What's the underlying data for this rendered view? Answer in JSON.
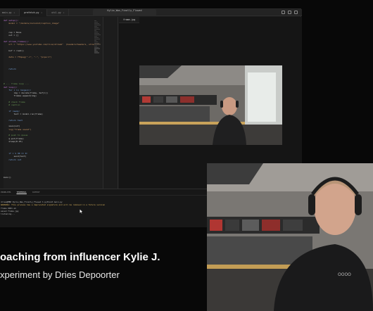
{
  "ide": {
    "window_title": "Kylie_Was_Finally_Flowed",
    "tabs": [
      {
        "label": "main.py",
        "active": false
      },
      {
        "label": "prefetch.py",
        "active": true
      },
      {
        "label": "util.py",
        "active": false
      }
    ],
    "preview_tab": "frame.jpg",
    "code_lines": [
      "def setup():",
      "    model = \"/models/zeroshot/caption_image\"",
      "",
      "",
      "    cap = None",
      "    out = []",
      "",
      "def stream_frames():",
      "    url = \"https://www.youtube.com/live/stream\"  (headers=headers, stream=True)",
      "",
      "    buf = read()",
      "",
      "    data = ffmpeg(\"-i\", \"-\", \"pipe:1\")",
      "",
      "",
      "",
      "    return",
      "",
      "",
      "",
      "",
      "# --- frame loop ---",
      "def loop():",
      "    for i in range(n):",
      "        img = decode(frame, buf[i])",
      "        frames.append(img)",
      "",
      "    # check frame",
      "    # caption",
      "",
      "    if ready:",
      "        text = model.run(frame)",
      "",
      "    return text",
      "",
      "    save(out)",
      "    log(\"frame saved\")",
      "",
      "    # push to queue",
      "    q.put(frame)",
      "    sleep(0.25)",
      "",
      "",
      "",
      "    if i % 30 == 0:",
      "        send(text)",
      "    return out",
      "",
      "",
      "",
      "",
      "",
      "main()"
    ],
    "terminal": {
      "tabs": [
        {
          "label": "PROBLEMS",
          "active": false
        },
        {
          "label": "TERMINAL",
          "active": true
        },
        {
          "label": "OUTPUT",
          "active": false
        }
      ],
      "lines": [
        "",
        "dries@MBP Kylie_Was_Finally_Flowed % python3 main.py",
        "WARNING: This process has a deprecated signature and will be removed in a future version",
        "frame 0001 ok",
        "saved frame.jpg",
        "listening..."
      ]
    }
  },
  "captions": {
    "line1": "oaching from influencer Kylie J.",
    "line2": "xperiment by Dries Depoorter"
  },
  "colors": {
    "background": "#080808",
    "ide_bg": "#1b1b1b",
    "caption": "#ffffff"
  }
}
